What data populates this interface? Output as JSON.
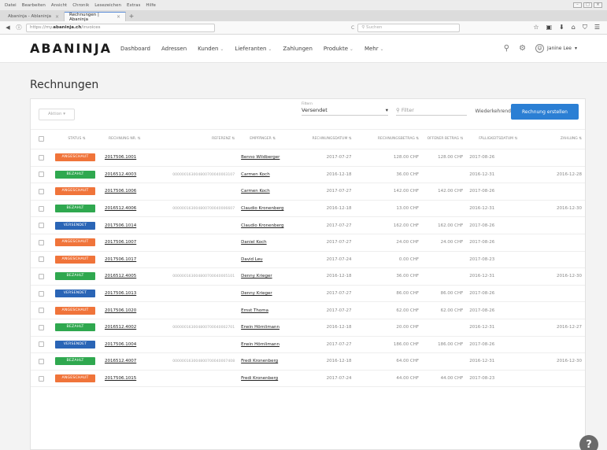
{
  "browser": {
    "menu": [
      "Datei",
      "Bearbeiten",
      "Ansicht",
      "Chronik",
      "Lesezeichen",
      "Extras",
      "Hilfe"
    ],
    "tabs": [
      {
        "label": "Abaninja - Ablaninja",
        "active": false
      },
      {
        "label": "Rechnungen | Abaninja",
        "active": true
      }
    ],
    "url_prefix": "https://my.",
    "url_host": "abaninja.ch",
    "url_path": "/invoices",
    "search_placeholder": "Suchen"
  },
  "header": {
    "logo": "ABANINJA",
    "nav": [
      {
        "label": "Dashboard",
        "dropdown": false
      },
      {
        "label": "Adressen",
        "dropdown": false
      },
      {
        "label": "Kunden",
        "dropdown": true
      },
      {
        "label": "Lieferanten",
        "dropdown": true
      },
      {
        "label": "Zahlungen",
        "dropdown": false
      },
      {
        "label": "Produkte",
        "dropdown": true
      },
      {
        "label": "Mehr",
        "dropdown": true
      }
    ],
    "user": "Janine Lee"
  },
  "page": {
    "title": "Rechnungen",
    "action_label": "Aktion",
    "filter_label": "Filtern",
    "filter_value": "Versendet",
    "filter_placeholder": "Filter",
    "recurring_label": "Wiederkehrend",
    "create_label": "Rechnung erstellen"
  },
  "table": {
    "columns": [
      {
        "key": "status",
        "label": "STATUS"
      },
      {
        "key": "nr",
        "label": "RECHNUNG NR."
      },
      {
        "key": "ref",
        "label": "REFERENZ"
      },
      {
        "key": "rcp",
        "label": "EMPFÄNGER"
      },
      {
        "key": "date",
        "label": "RECHNUNGSDATUM"
      },
      {
        "key": "amt",
        "label": "RECHNUNGSBETRAG"
      },
      {
        "key": "open",
        "label": "OFFENER BETRAG"
      },
      {
        "key": "due",
        "label": "FÄLLIGKEITSDATUM"
      },
      {
        "key": "pay",
        "label": "ZAHLUNG"
      }
    ],
    "rows": [
      {
        "status": "ANGESCHAUT",
        "nr": "2017506.1001",
        "ref": "",
        "rcp": "Benno Wildberger",
        "date": "2017-07-27",
        "amt": "128.00 CHF",
        "open": "128.00 CHF",
        "due": "2017-08-26",
        "pay": ""
      },
      {
        "status": "BEZAHLT",
        "nr": "2016512.4003",
        "ref": "000000163004800700040003107",
        "rcp": "Carmen Koch",
        "date": "2016-12-18",
        "amt": "36.00 CHF",
        "open": "",
        "due": "2016-12-31",
        "pay": "2016-12-28"
      },
      {
        "status": "ANGESCHAUT",
        "nr": "2017506.1006",
        "ref": "",
        "rcp": "Carmen Koch",
        "date": "2017-07-27",
        "amt": "142.00 CHF",
        "open": "142.00 CHF",
        "due": "2017-08-26",
        "pay": ""
      },
      {
        "status": "BEZAHLT",
        "nr": "2016512.4006",
        "ref": "000000163004800700040006607",
        "rcp": "Claudio Kronenberg",
        "date": "2016-12-18",
        "amt": "13.00 CHF",
        "open": "",
        "due": "2016-12-31",
        "pay": "2016-12-30"
      },
      {
        "status": "VERSENDET",
        "nr": "2017506.1014",
        "ref": "",
        "rcp": "Claudio Kronenberg",
        "date": "2017-07-27",
        "amt": "162.00 CHF",
        "open": "162.00 CHF",
        "due": "2017-08-26",
        "pay": ""
      },
      {
        "status": "ANGESCHAUT",
        "nr": "2017506.1007",
        "ref": "",
        "rcp": "Daniel Koch",
        "date": "2017-07-27",
        "amt": "24.00 CHF",
        "open": "24.00 CHF",
        "due": "2017-08-26",
        "pay": ""
      },
      {
        "status": "ANGESCHAUT",
        "nr": "2017506.1017",
        "ref": "",
        "rcp": "David Leu",
        "date": "2017-07-24",
        "amt": "0.00 CHF",
        "open": "",
        "due": "2017-08-23",
        "pay": ""
      },
      {
        "status": "BEZAHLT",
        "nr": "2016512.4005",
        "ref": "000000163004800700040005101",
        "rcp": "Denny Krieger",
        "date": "2016-12-18",
        "amt": "36.00 CHF",
        "open": "",
        "due": "2016-12-31",
        "pay": "2016-12-30"
      },
      {
        "status": "VERSENDET",
        "nr": "2017506.1013",
        "ref": "",
        "rcp": "Denny Krieger",
        "date": "2017-07-27",
        "amt": "86.00 CHF",
        "open": "86.00 CHF",
        "due": "2017-08-26",
        "pay": ""
      },
      {
        "status": "ANGESCHAUT",
        "nr": "2017506.1020",
        "ref": "",
        "rcp": "Ernst Thoma",
        "date": "2017-07-27",
        "amt": "62.00 CHF",
        "open": "62.00 CHF",
        "due": "2017-08-26",
        "pay": ""
      },
      {
        "status": "BEZAHLT",
        "nr": "2016512.4002",
        "ref": "000000163004800700040002701",
        "rcp": "Erwin Hörnlimann",
        "date": "2016-12-18",
        "amt": "20.00 CHF",
        "open": "",
        "due": "2016-12-31",
        "pay": "2016-12-27"
      },
      {
        "status": "VERSENDET",
        "nr": "2017506.1004",
        "ref": "",
        "rcp": "Erwin Hörnlimann",
        "date": "2017-07-27",
        "amt": "186.00 CHF",
        "open": "186.00 CHF",
        "due": "2017-08-26",
        "pay": ""
      },
      {
        "status": "BEZAHLT",
        "nr": "2016512.4007",
        "ref": "000000163004800700040007408",
        "rcp": "Fredi Kronenberg",
        "date": "2016-12-18",
        "amt": "64.00 CHF",
        "open": "",
        "due": "2016-12-31",
        "pay": "2016-12-30"
      },
      {
        "status": "ANGESCHAUT",
        "nr": "2017506.1015",
        "ref": "",
        "rcp": "Fredi Kronenberg",
        "date": "2017-07-24",
        "amt": "44.00 CHF",
        "open": "44.00 CHF",
        "due": "2017-08-23",
        "pay": ""
      }
    ]
  }
}
